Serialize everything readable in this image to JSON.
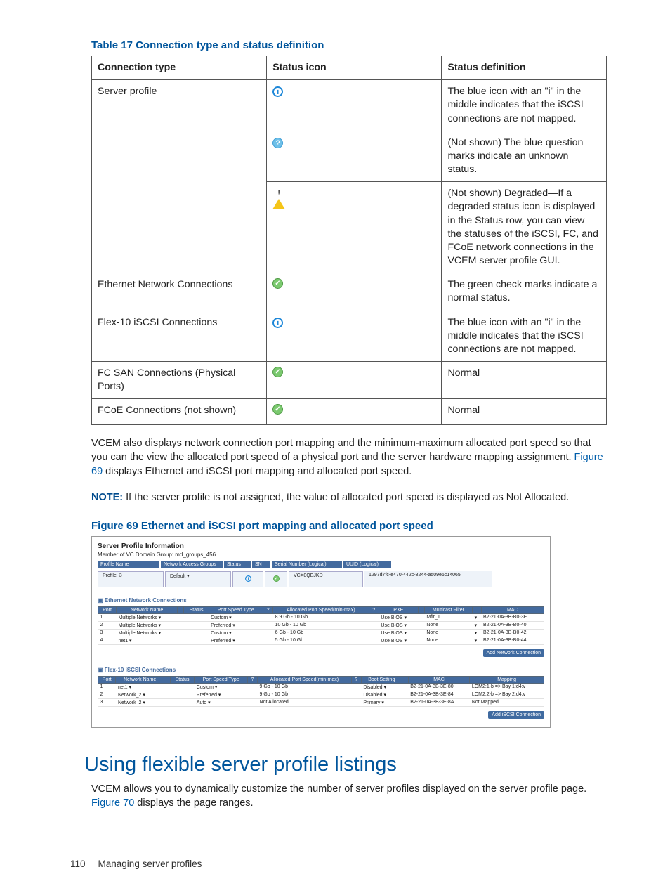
{
  "table17": {
    "title": "Table 17 Connection type and status definition",
    "headers": [
      "Connection type",
      "Status icon",
      "Status definition"
    ],
    "rows": [
      {
        "connection_type": "Server profile",
        "icon": "info",
        "definition": "The blue icon with an \"i\" in the middle indicates that the iSCSI connections are not mapped.",
        "rowspan": 3
      },
      {
        "connection_type": "",
        "icon": "question",
        "definition": "(Not shown) The blue question marks indicate an unknown status."
      },
      {
        "connection_type": "",
        "icon": "warn",
        "definition": "(Not shown) Degraded—If a degraded status icon is displayed in the Status row, you can view the statuses of the iSCSI, FC, and FCoE network connections in the VCEM server profile GUI."
      },
      {
        "connection_type": "Ethernet Network Connections",
        "icon": "check",
        "definition": "The green check marks indicate a normal status."
      },
      {
        "connection_type": "Flex-10 iSCSI Connections",
        "icon": "info",
        "definition": "The blue icon with an \"i\" in the middle indicates that the iSCSI connections are not mapped."
      },
      {
        "connection_type": "FC SAN Connections (Physical Ports)",
        "icon": "check",
        "definition": "Normal"
      },
      {
        "connection_type": "FCoE Connections (not shown)",
        "icon": "check",
        "definition": "Normal"
      }
    ]
  },
  "para1_a": "VCEM also displays network connection port mapping and the minimum-maximum allocated port speed so that you can the view the allocated port speed  of a physical port and the server hardware mapping assignment. ",
  "para1_link": "Figure 69",
  "para1_b": " displays Ethernet and iSCSI port mapping and allocated port speed.",
  "note_label": "NOTE:",
  "note_text": "   If the server profile is not assigned, the value of allocated port speed is displayed as Not Allocated.",
  "figure69_title": "Figure 69 Ethernet and iSCSI port mapping and allocated port speed",
  "screenshot": {
    "title": "Server Profile Information",
    "sub": "Member of VC Domain Group: md_groups_456",
    "bars": {
      "profile_name_h": "Profile Name",
      "profile_name_v": "Profile_3",
      "nag_h": "Network Access Groups",
      "nag_v": "Default ▾",
      "status_h": "Status",
      "sn_h": "SN",
      "snl_h": "Serial Number (Logical)",
      "snl_v": "VCX0QEJKD",
      "uuid_h": "UUID (Logical)",
      "uuid_v": "1297d7fc-e470-442c-8244-a509e6c14065"
    },
    "eth_label": "Ethernet Network Connections",
    "eth_headers": [
      "Port",
      "Network Name",
      "",
      "Status",
      "Port Speed Type",
      "?",
      "Allocated Port Speed(min-max)",
      "?",
      "PXE",
      "",
      "Multicast Filter",
      "",
      "MAC"
    ],
    "eth_rows": [
      [
        "1",
        "Multiple Networks ▾",
        "",
        "",
        "Custom ▾",
        "",
        "8.9 Gb - 10 Gb",
        "",
        "Use BIOS ▾",
        "",
        "Mflr_1",
        "▾",
        "B2-21-0A-3B-B0-3E"
      ],
      [
        "2",
        "Multiple Networks ▾",
        "",
        "",
        "Preferred ▾",
        "",
        "10 Gb - 10 Gb",
        "",
        "Use BIOS ▾",
        "",
        "None",
        "▾",
        "B2-21-0A-3B-B0-40"
      ],
      [
        "3",
        "Multiple Networks ▾",
        "",
        "",
        "Custom ▾",
        "",
        "6 Gb - 10 Gb",
        "",
        "Use BIOS ▾",
        "",
        "None",
        "▾",
        "B2-21-0A-3B-B0-42"
      ],
      [
        "4",
        "net1             ▾",
        "",
        "",
        "Preferred ▾",
        "",
        "5 Gb - 10 Gb",
        "",
        "Use BIOS ▾",
        "",
        "None",
        "▾",
        "B2-21-0A-3B-B0-44"
      ]
    ],
    "btn_add_net": "Add Network Connection",
    "iscsi_label": "Flex-10 iSCSI Connections",
    "iscsi_headers": [
      "Port",
      "Network Name",
      "",
      "Status",
      "Port Speed Type",
      "?",
      "Allocated Port Speed(min-max)",
      "?",
      "Boot Setting",
      "",
      "MAC",
      "Mapping"
    ],
    "iscsi_rows": [
      [
        "1",
        "net1      ▾",
        "",
        "",
        "Custom ▾",
        "",
        "9 Gb - 10 Gb",
        "",
        "Disabled ▾",
        "",
        "B2-21-0A-3B-3E-80",
        "LOM2:1-b => Bay 1:d4:v"
      ],
      [
        "2",
        "Network_2 ▾",
        "",
        "",
        "Preferred ▾",
        "",
        "9 Gb - 10 Gb",
        "",
        "Disabled ▾",
        "",
        "B2-21-0A-3B-3E-84",
        "LOM2:2-b => Bay 2:d4:v"
      ],
      [
        "3",
        "Network_2 ▾",
        "",
        "",
        "Auto ▾",
        "",
        "Not Allocated",
        "",
        "Primary ▾",
        "",
        "B2-21-0A-3B-3E-8A",
        "Not Mapped"
      ]
    ],
    "btn_add_iscsi": "Add iSCSI Connection"
  },
  "heading": "Using flexible server profile listings",
  "para2_a": "VCEM allows you to dynamically customize the number of server profiles displayed on the server profile page. ",
  "para2_link": "Figure 70",
  "para2_b": " displays the page ranges.",
  "footer": {
    "page": "110",
    "title": "Managing server profiles"
  }
}
